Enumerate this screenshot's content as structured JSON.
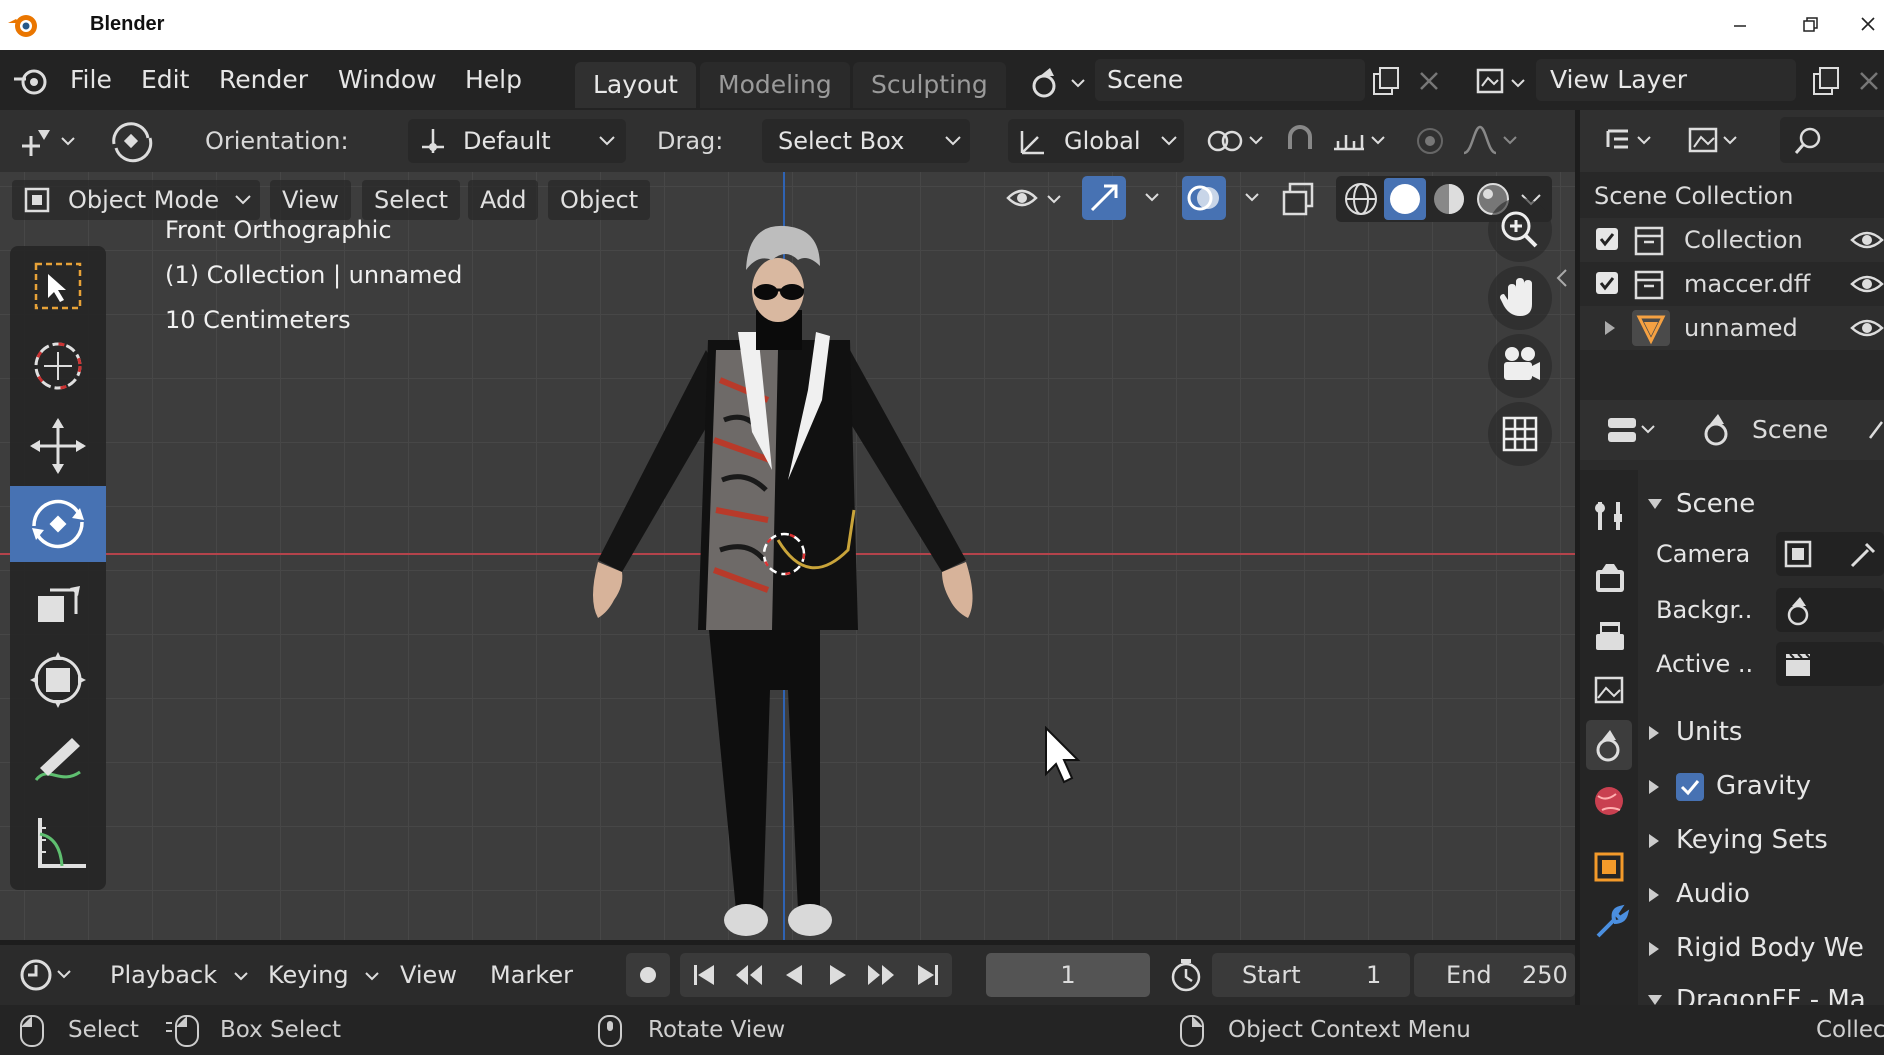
{
  "window": {
    "title": "Blender"
  },
  "menu": {
    "file": "File",
    "edit": "Edit",
    "render": "Render",
    "window": "Window",
    "help": "Help"
  },
  "workspaces": [
    "Layout",
    "Modeling",
    "Sculpting"
  ],
  "scene_field": "Scene",
  "view_layer_field": "View Layer",
  "tool_header": {
    "orientation_label": "Orientation:",
    "orientation_value": "Default",
    "drag_label": "Drag:",
    "drag_value": "Select Box",
    "transform_orientation": "Global"
  },
  "viewport_header": {
    "mode": "Object Mode",
    "view": "View",
    "select": "Select",
    "add": "Add",
    "object": "Object"
  },
  "viewport_overlay": {
    "line1": "Front Orthographic",
    "line2": "(1) Collection | unnamed",
    "line3": "10 Centimeters"
  },
  "outliner": {
    "root": "Scene Collection",
    "items": [
      "Collection",
      "maccer.dff",
      "unnamed"
    ]
  },
  "properties": {
    "header": "Scene",
    "panel": "Scene",
    "camera": "Camera",
    "background": "Backgr..",
    "active": "Active ..",
    "sections": [
      "Units",
      "Gravity",
      "Keying Sets",
      "Audio",
      "Rigid Body We",
      "DragonFF - Ma"
    ]
  },
  "timeline": {
    "playback": "Playback",
    "keying": "Keying",
    "view": "View",
    "marker": "Marker",
    "current_frame": "1",
    "start_label": "Start",
    "start_value": "1",
    "end_label": "End",
    "end_value": "250"
  },
  "statusbar": {
    "select": "Select",
    "box_select": "Box Select",
    "rotate_view": "Rotate View",
    "context_menu": "Object Context Menu",
    "right": "Collec"
  },
  "colors": {
    "accent": "#4772b3",
    "x_axis": "#c2464e",
    "z_axis": "#2f63b3"
  }
}
